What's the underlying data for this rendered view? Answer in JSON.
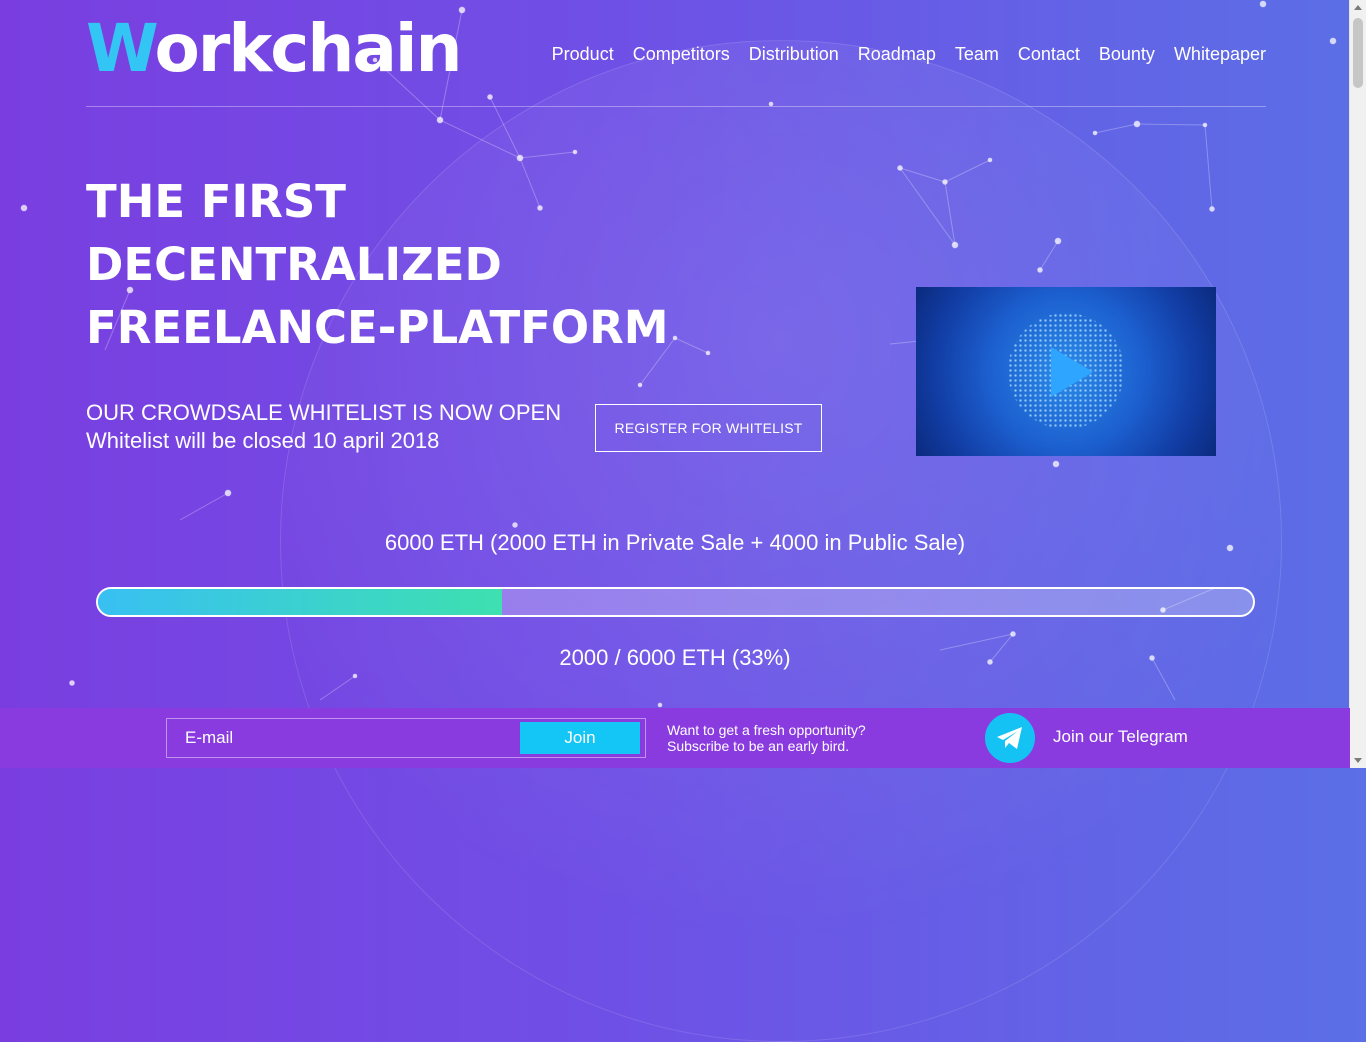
{
  "header": {
    "logo_first": "W",
    "logo_rest": "orkchain",
    "nav": [
      "Product",
      "Competitors",
      "Distribution",
      "Roadmap",
      "Team",
      "Contact",
      "Bounty",
      "Whitepaper"
    ]
  },
  "hero": {
    "title_lines": [
      "THE FIRST",
      "DECENTRALIZED",
      "FREELANCE-PLATFORM"
    ],
    "whitelist_title": "OUR CROWDSALE WHITELIST IS NOW OPEN",
    "whitelist_subtitle": "Whitelist will be closed 10 april 2018",
    "register_button": "REGISTER FOR WHITELIST"
  },
  "video": {
    "icon": "play-icon"
  },
  "crowdsale": {
    "cap_text": "6000 ETH (2000 ETH in Private Sale + 4000 in Public Sale)",
    "raised_text": "2000 / 6000 ETH (33%)",
    "progress_fraction": 0.35
  },
  "footer": {
    "email_placeholder": "E-mail",
    "join_button": "Join",
    "subscribe_line1": "Want to get a fresh opportunity?",
    "subscribe_line2": "Subscribe to be an early bird.",
    "telegram_label": "Join our Telegram",
    "telegram_icon": "telegram-icon"
  },
  "colors": {
    "accent": "#33c6f4",
    "footer_bg": "#8a3be0",
    "progress_start": "#38c0f2",
    "progress_end": "#3ee0b0"
  }
}
